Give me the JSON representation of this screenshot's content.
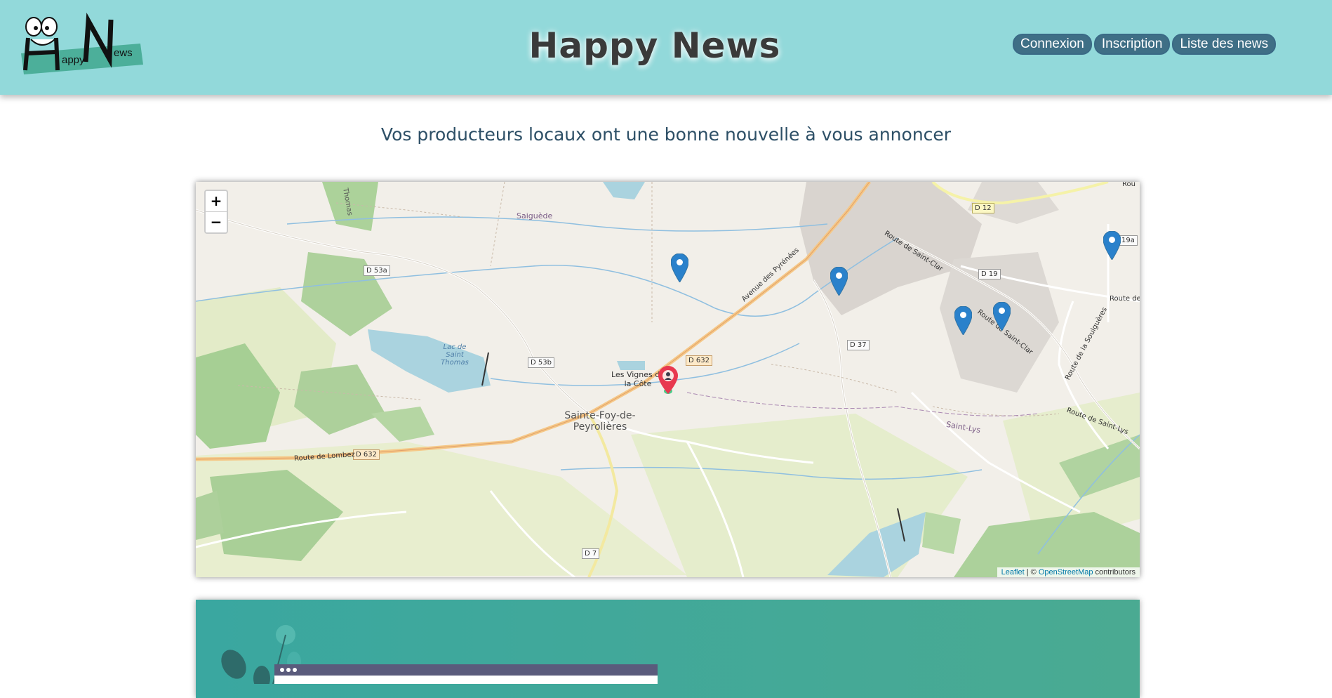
{
  "header": {
    "title": "Happy News",
    "logo_text": "HappyNews",
    "nav": {
      "login": "Connexion",
      "signup": "Inscription",
      "news_list": "Liste des news"
    }
  },
  "subtitle": "Vos producteurs locaux ont une bonne nouvelle à vous annoncer",
  "map": {
    "zoom_in": "+",
    "zoom_out": "−",
    "attribution": {
      "leaflet": "Leaflet",
      "sep": " | © ",
      "osm": "OpenStreetMap",
      "suffix": " contributors"
    },
    "places": {
      "saiguede": "Saiguède",
      "lac": "Lac de Saint Thomas",
      "vignes": "Les Vignes de la Côte",
      "sainte_foy": "Sainte-Foy-de-Peyrolières",
      "saint_lys": "Saint-Lys",
      "thomas": "Thomas"
    },
    "roads": {
      "d53a": "D 53a",
      "d53b": "D 53b",
      "d632a": "D 632",
      "d632b": "D 632",
      "d12": "D 12",
      "d19": "D 19",
      "d19a": "19a",
      "d37": "D 37",
      "d7": "D 7",
      "lombez": "Route de Lombez",
      "pyrenees": "Avenue des Pyrénées",
      "saint_clar1": "Route de Saint-Clar",
      "saint_clar2": "Route de Saint-Clar",
      "saint_lys": "Route de Saint-Lys",
      "soulgueres": "Route de la Soulguères",
      "route_l": "Route de L",
      "rou": "Rou"
    },
    "markers": [
      "blue",
      "blue",
      "blue",
      "blue",
      "blue"
    ],
    "user_marker": "red"
  },
  "colors": {
    "header_bg": "#92d9da",
    "nav_btn": "#3f6f86",
    "marker": "#2a81cb",
    "user_marker": "#e8384f",
    "card": "#3aa7a0"
  }
}
